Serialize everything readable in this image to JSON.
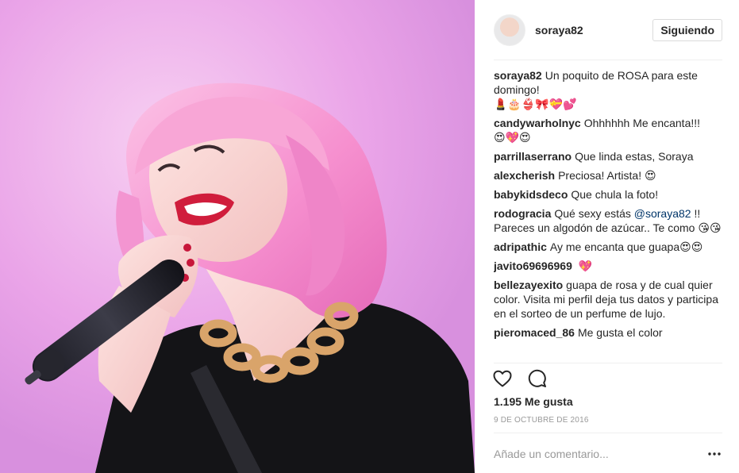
{
  "post": {
    "username": "soraya82",
    "follow_label": "Siguiendo",
    "likes": "1.195 Me gusta",
    "date": "9 DE OCTUBRE DE 2016",
    "comment_placeholder": "Añade un comentario..."
  },
  "comments": [
    {
      "user": "soraya82",
      "text": "Un poquito de ROSA para este domingo!",
      "emoji": "💄🎂👙🎀💝💕"
    },
    {
      "user": "candywarholnyc",
      "text": "Ohhhhhh Me encanta!!!",
      "emoji": "😍💖😍"
    },
    {
      "user": "parrillaserrano",
      "text": "Que linda estas, Soraya",
      "emoji": ""
    },
    {
      "user": "alexcherish",
      "text": "Preciosa! Artista!",
      "emoji": "😍"
    },
    {
      "user": "babykidsdeco",
      "text": "Que chula la foto!",
      "emoji": ""
    },
    {
      "user": "rodogracia",
      "text": "Qué sexy estás",
      "mention": "@soraya82",
      "text2": "!! Pareces un algodón de azúcar.. Te como",
      "emoji": "😘😘"
    },
    {
      "user": "adripathic",
      "text": "Ay me encanta que guapa",
      "emoji": "😍😍"
    },
    {
      "user": "javito69696969",
      "text": "",
      "emoji": "💖"
    },
    {
      "user": "bellezayexito",
      "text": "guapa de rosa y de cual quier color. Visita mi perfil deja tus datos y participa en el sorteo de un perfume de lujo.",
      "emoji": ""
    },
    {
      "user": "pieromaced_86",
      "text": "Me gusta el color",
      "emoji": ""
    }
  ],
  "icons": {
    "like": "heart-outline-icon",
    "comment": "speech-bubble-icon",
    "more": "more-dots-icon"
  },
  "colors": {
    "photo_bg": "#e99ae6",
    "hair": "#f7a0d6",
    "text": "#262626",
    "muted": "#999999",
    "mention": "#003569",
    "border": "#dbdbdb"
  }
}
